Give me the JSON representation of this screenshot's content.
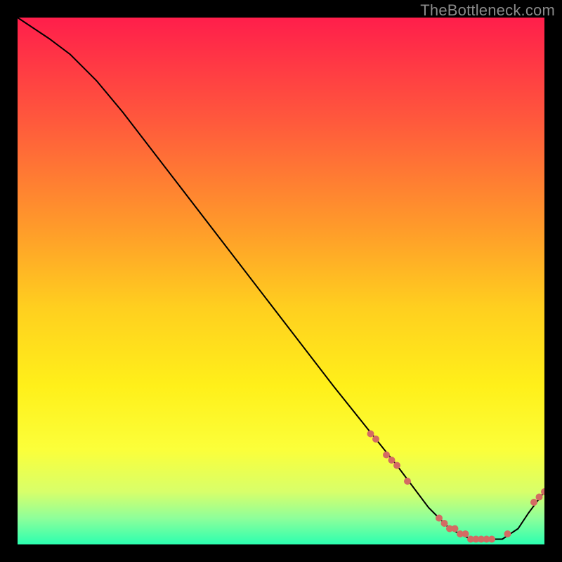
{
  "watermark": "TheBottleneck.com",
  "chart_data": {
    "type": "line",
    "title": "",
    "xlabel": "",
    "ylabel": "",
    "xlim": [
      0,
      100
    ],
    "ylim": [
      0,
      100
    ],
    "grid": false,
    "legend": false,
    "background_gradient": {
      "stops": [
        {
          "offset": 0.0,
          "color": "#ff1e4b"
        },
        {
          "offset": 0.2,
          "color": "#ff5a3c"
        },
        {
          "offset": 0.4,
          "color": "#ff9b2a"
        },
        {
          "offset": 0.55,
          "color": "#ffcf1f"
        },
        {
          "offset": 0.7,
          "color": "#fff01a"
        },
        {
          "offset": 0.82,
          "color": "#fbff3a"
        },
        {
          "offset": 0.9,
          "color": "#d8ff6a"
        },
        {
          "offset": 0.95,
          "color": "#8eff9a"
        },
        {
          "offset": 1.0,
          "color": "#2bffb0"
        }
      ]
    },
    "series": [
      {
        "name": "bottleneck-curve",
        "color": "#000000",
        "x": [
          0,
          3,
          6,
          10,
          15,
          20,
          30,
          40,
          50,
          60,
          68,
          72,
          75,
          78,
          80,
          82,
          84,
          86,
          88,
          90,
          92,
          95,
          97,
          100
        ],
        "y": [
          100,
          98,
          96,
          93,
          88,
          82,
          69,
          56,
          43,
          30,
          20,
          15,
          11,
          7,
          5,
          3,
          2,
          1,
          1,
          1,
          1,
          3,
          6,
          10
        ]
      }
    ],
    "markers": {
      "name": "highlight-points",
      "color": "#d46a63",
      "radius": 5,
      "points": [
        {
          "x": 67,
          "y": 21
        },
        {
          "x": 68,
          "y": 20
        },
        {
          "x": 70,
          "y": 17
        },
        {
          "x": 71,
          "y": 16
        },
        {
          "x": 72,
          "y": 15
        },
        {
          "x": 74,
          "y": 12
        },
        {
          "x": 80,
          "y": 5
        },
        {
          "x": 81,
          "y": 4
        },
        {
          "x": 82,
          "y": 3
        },
        {
          "x": 83,
          "y": 3
        },
        {
          "x": 84,
          "y": 2
        },
        {
          "x": 85,
          "y": 2
        },
        {
          "x": 86,
          "y": 1
        },
        {
          "x": 87,
          "y": 1
        },
        {
          "x": 88,
          "y": 1
        },
        {
          "x": 89,
          "y": 1
        },
        {
          "x": 90,
          "y": 1
        },
        {
          "x": 93,
          "y": 2
        },
        {
          "x": 98,
          "y": 8
        },
        {
          "x": 99,
          "y": 9
        },
        {
          "x": 100,
          "y": 10
        }
      ]
    }
  }
}
